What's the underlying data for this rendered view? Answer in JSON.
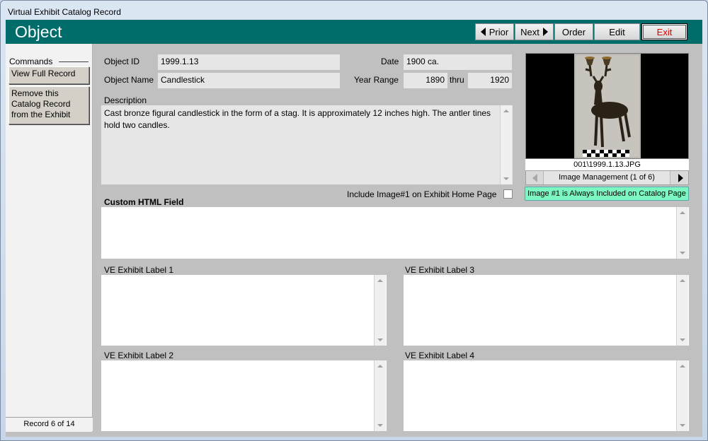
{
  "window": {
    "title": "Virtual Exhibit Catalog Record"
  },
  "header": {
    "title": "Object",
    "prior_label": "Prior",
    "next_label": "Next",
    "order_label": "Order",
    "edit_label": "Edit",
    "exit_label": "Exit",
    "exit_color": "#e00000",
    "bg_color": "#006d6a"
  },
  "commands": {
    "label": "Commands",
    "view_full_record": "View Full Record",
    "remove_from_exhibit": "Remove this Catalog Record from the Exhibit"
  },
  "record_status": "Record 6 of 14",
  "fields": {
    "object_id_label": "Object ID",
    "object_id": "1999.1.13",
    "object_name_label": "Object Name",
    "object_name": "Candlestick",
    "date_label": "Date",
    "date": "1900 ca.",
    "year_range_label": "Year Range",
    "year_from": "1890",
    "thru_label": "thru",
    "year_to": "1920",
    "description_label": "Description",
    "description": "Cast bronze figural candlestick in the form of a stag. It is approximately 12 inches high. The antler tines hold two candles.",
    "include_image_label": "Include Image#1 on Exhibit Home Page",
    "include_image_checked": false,
    "custom_html_label": "Custom HTML Field",
    "ve_label_1": "VE Exhibit Label 1",
    "ve_label_2": "VE Exhibit Label 2",
    "ve_label_3": "VE Exhibit Label 3",
    "ve_label_4": "VE Exhibit Label 4"
  },
  "image": {
    "caption": "001\\1999.1.13.JPG",
    "management_label": "Image Management (1 of 6)",
    "always_included_note": "Image #1 is Always Included on Catalog Page",
    "note_color": "#7df7c1"
  }
}
